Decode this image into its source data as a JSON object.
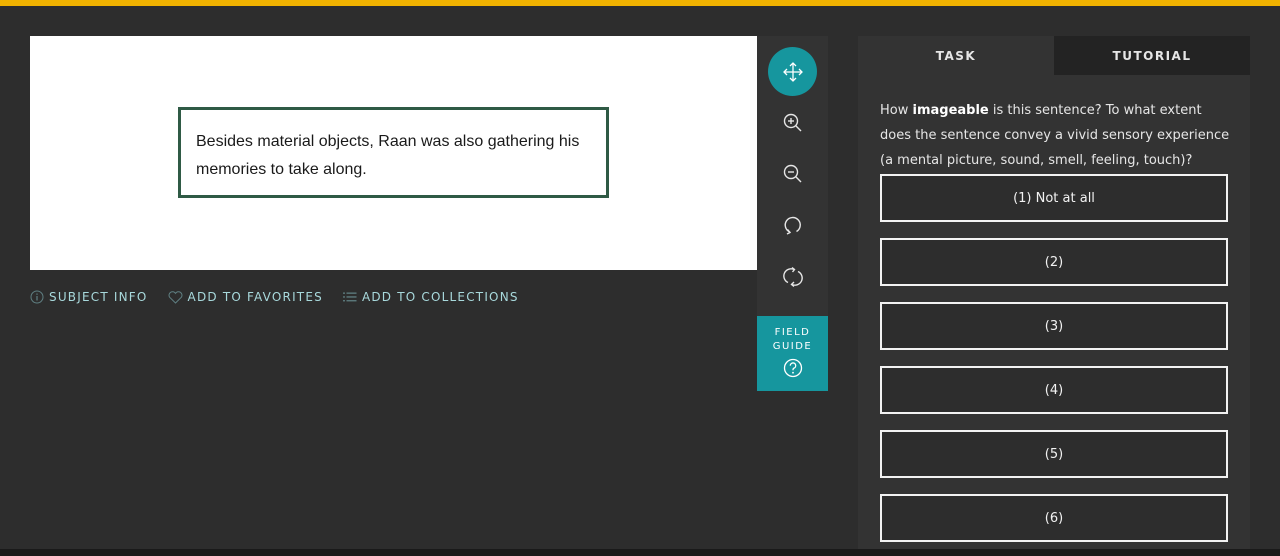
{
  "subject": {
    "sentence": "Besides material objects, Raan was also gathering his memories to take along."
  },
  "meta_links": [
    {
      "label": "SUBJECT INFO",
      "icon": "info-icon"
    },
    {
      "label": "ADD TO FAVORITES",
      "icon": "heart-icon"
    },
    {
      "label": "ADD TO COLLECTIONS",
      "icon": "list-icon"
    }
  ],
  "toolbar": {
    "tools": [
      "move-icon",
      "zoom-in-icon",
      "zoom-out-icon",
      "rotate-icon",
      "reset-icon"
    ],
    "field_guide_line1": "FIELD",
    "field_guide_line2": "GUIDE"
  },
  "task": {
    "tabs": {
      "task": "TASK",
      "tutorial": "TUTORIAL"
    },
    "question_prefix": "How ",
    "question_bold": "imageable",
    "question_suffix": " is this sentence? To what extent does the sentence convey a vivid sensory experience (a mental picture, sound, smell, feeling, touch)?",
    "answers": [
      "(1) Not at all",
      "(2)",
      "(3)",
      "(4)",
      "(5)",
      "(6)"
    ]
  },
  "colors": {
    "accent": "#16969e",
    "top_bar": "#f0b200",
    "link": "#a8d9dc"
  }
}
